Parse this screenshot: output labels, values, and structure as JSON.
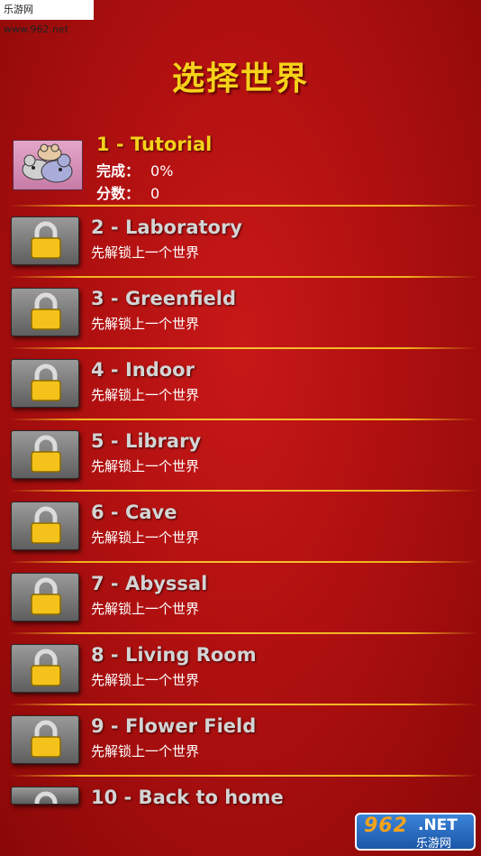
{
  "watermark": "乐游网 www.962.net",
  "title": "选择世界",
  "tutorial": {
    "name": "1 - Tutorial",
    "completion_label": "完成：",
    "completion_value": "0%",
    "score_label": "分数：",
    "score_value": "0"
  },
  "locked_text": "先解锁上一个世界",
  "worlds": [
    {
      "name": "2 - Laboratory",
      "status": "先解锁上一个世界"
    },
    {
      "name": "3 - Greenfield",
      "status": "先解锁上一个世界"
    },
    {
      "name": "4 - Indoor",
      "status": "先解锁上一个世界"
    },
    {
      "name": "5 - Library",
      "status": "先解锁上一个世界"
    },
    {
      "name": "6 - Cave",
      "status": "先解锁上一个世界"
    },
    {
      "name": "7 - Abyssal",
      "status": "先解锁上一个世界"
    },
    {
      "name": "8 - Living Room",
      "status": "先解锁上一个世界"
    },
    {
      "name": "9 - Flower Field",
      "status": "先解锁上一个世界"
    },
    {
      "name": "10 - Back to home",
      "status": ""
    }
  ],
  "badge": {
    "digits": "962",
    "suffix": ".NET",
    "cn": "乐游网"
  },
  "colors": {
    "title": "#f5d21a",
    "separator": "#f2b21e",
    "background": "#b01010"
  }
}
